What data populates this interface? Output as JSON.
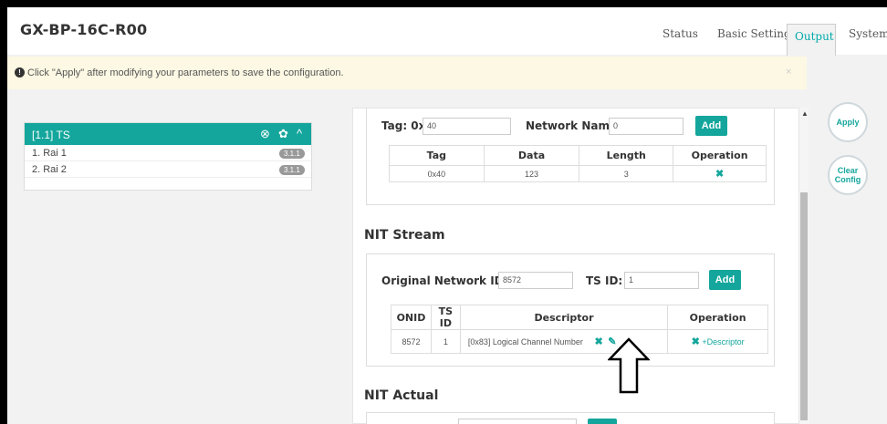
{
  "header": {
    "brand": "GX-BP-16C-R00",
    "nav": [
      "Status",
      "Basic Setting",
      "Output",
      "System"
    ],
    "active_tab": "Output"
  },
  "notice": {
    "icon": "exclamation-circle-icon",
    "text": "Click \"Apply\" after modifying your parameters to save the configuration.",
    "close": "×"
  },
  "left_panel": {
    "ts_title": "[1.1] TS",
    "icons": [
      "close-circle-icon",
      "gear-icon",
      "chevron-up-icon"
    ],
    "items": [
      {
        "label": "1. Rai 1",
        "badge": "3.1.1"
      },
      {
        "label": "2. Rai 2",
        "badge": "3.1.1"
      }
    ]
  },
  "tag_section": {
    "tag_label": "Tag: 0x",
    "tag_value": "40",
    "network_name_label": "Network Name:",
    "network_name_value": "0",
    "add_label": "Add",
    "table": {
      "headers": [
        "Tag",
        "Data",
        "Length",
        "Operation"
      ],
      "rows": [
        {
          "tag": "0x40",
          "data": "123",
          "length": "3",
          "operation": "✖"
        }
      ]
    }
  },
  "nit_stream": {
    "title": "NIT Stream",
    "onid_label": "Original Network ID:",
    "onid_value": "8572",
    "tsid_label": "TS ID:",
    "tsid_value": "1",
    "add_label": "Add",
    "table": {
      "headers": [
        "ONID",
        "TS ID",
        "Descriptor",
        "Operation"
      ],
      "rows": [
        {
          "onid": "8572",
          "tsid": "1",
          "descriptor": "[0x83] Logical Channel Number",
          "desc_delete": "✖",
          "desc_edit": "✎",
          "op_delete": "✖",
          "op_add": "+Descriptor"
        }
      ]
    }
  },
  "nit_actual": {
    "title": "NIT Actual"
  },
  "side_buttons": {
    "apply": "Apply",
    "clear_config": "Clear Config"
  },
  "scrollbar": {
    "up": "▲"
  }
}
